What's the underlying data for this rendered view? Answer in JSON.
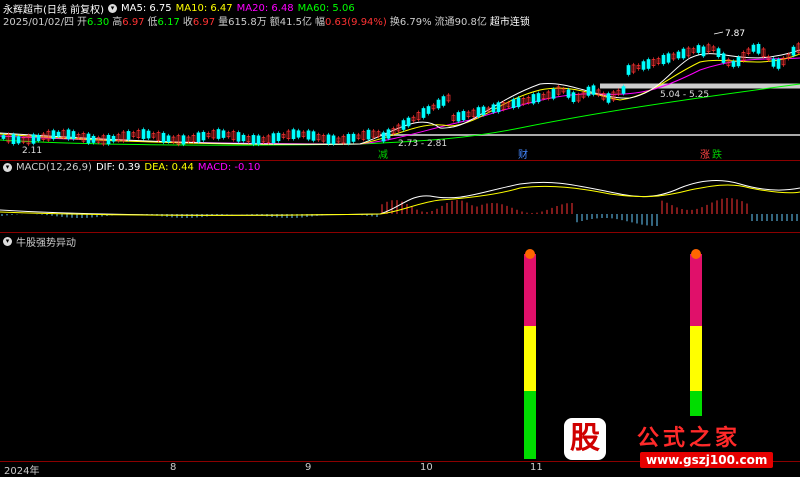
{
  "header": {
    "title": "永辉超市(日线 前复权)",
    "ma": [
      {
        "label": "MA5: 6.75",
        "color": "#ffffff"
      },
      {
        "label": "MA10: 6.47",
        "color": "#ffff00"
      },
      {
        "label": "MA20: 6.48",
        "color": "#ff00ff"
      },
      {
        "label": "MA60: 5.06",
        "color": "#00ff00"
      }
    ],
    "date": "2025/01/02/四",
    "quotes": [
      {
        "k": "开",
        "v": "6.30",
        "c": "#00ff00"
      },
      {
        "k": "高",
        "v": "6.97",
        "c": "#ff3333"
      },
      {
        "k": "低",
        "v": "6.17",
        "c": "#00ff00"
      },
      {
        "k": "收",
        "v": "6.97",
        "c": "#ff3333"
      },
      {
        "k": "量",
        "v": "615.8万",
        "c": "#cccccc"
      },
      {
        "k": "额",
        "v": "41.5亿",
        "c": "#cccccc"
      },
      {
        "k": "幅",
        "v": "0.63(9.94%)",
        "c": "#ff3333"
      },
      {
        "k": "换",
        "v": "6.79%",
        "c": "#cccccc"
      },
      {
        "k": "流通",
        "v": "90.8亿",
        "c": "#cccccc"
      }
    ],
    "sector": "超市连锁"
  },
  "price_annotations": {
    "high": "7.87",
    "zone_upper": "5.04 - 5.25",
    "zone_lower": "2.73 - 2.81",
    "low": "2.11",
    "events": [
      {
        "label": "减",
        "color": "#00cc00"
      },
      {
        "label": "财",
        "color": "#4488ff"
      },
      {
        "label": "涨",
        "color": "#ff4444"
      },
      {
        "label": "跌",
        "color": "#00cc00"
      }
    ]
  },
  "macd": {
    "title": "MACD(12,26,9)",
    "dif": "DIF: 0.39",
    "dea": "DEA: 0.44",
    "macd": "MACD: -0.10"
  },
  "indicator": {
    "title": "牛股强势异动"
  },
  "time_axis": [
    "2024年",
    "8",
    "9",
    "10",
    "11"
  ],
  "watermark": {
    "logo": "股",
    "name": "公式之家",
    "url": "www.gszj100.com"
  }
}
